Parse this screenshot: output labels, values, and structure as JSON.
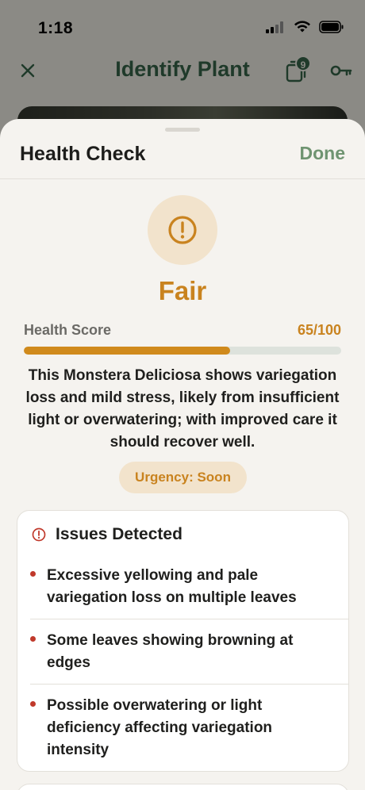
{
  "status_bar": {
    "time": "1:18"
  },
  "nav": {
    "title": "Identify Plant",
    "gallery_badge": "9"
  },
  "sheet": {
    "title": "Health Check",
    "done_label": "Done",
    "status": "Fair",
    "score_label": "Health Score",
    "score_text": "65/100",
    "score_fraction": 0.65,
    "summary": "This Monstera Deliciosa shows variegation loss and mild stress, likely from insufficient light or overwatering; with improved care it should recover well.",
    "urgency": "Urgency: Soon"
  },
  "issues": {
    "title": "Issues Detected",
    "items": [
      "Excessive yellowing and pale variegation loss on multiple leaves",
      "Some leaves showing browning at edges",
      "Possible overwatering or light deficiency affecting variegation intensity"
    ]
  },
  "colors": {
    "accent_amber": "#c9831f",
    "done_green": "#6f9471",
    "issue_red": "#c0392b",
    "sheet_bg": "#f5f3ef"
  },
  "icons": [
    "close-icon",
    "gallery-icon",
    "key-icon",
    "alert-icon",
    "alert-small-icon"
  ]
}
